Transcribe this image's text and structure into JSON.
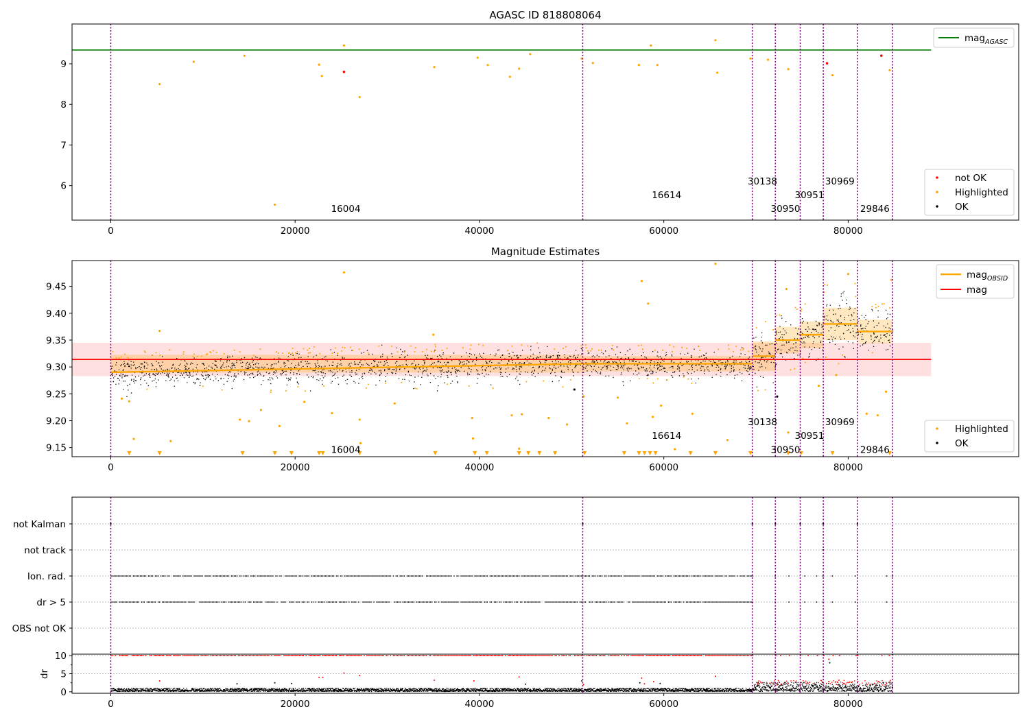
{
  "chart_data": [
    {
      "type": "scatter",
      "title": "AGASC ID 818808064",
      "xlabel": "",
      "ylabel": "",
      "xlim": [
        -4200,
        98500
      ],
      "ylim": [
        5.15,
        9.98
      ],
      "xticks": [
        0,
        20000,
        40000,
        60000,
        80000
      ],
      "xtick_labels": [
        "0",
        "20000",
        "40000",
        "60000",
        "80000"
      ],
      "yticks": [
        6,
        7,
        8,
        9
      ],
      "ytick_labels": [
        "6",
        "7",
        "8",
        "9"
      ],
      "reference_line": {
        "name": "mag_AGASC",
        "y": 9.34,
        "x_range": [
          -4200,
          89000
        ],
        "color": "#008000"
      },
      "obsid_boundaries": [
        0,
        51200,
        69600,
        72100,
        74800,
        77300,
        81000,
        84800
      ],
      "obsid_labels": [
        {
          "text": "16004",
          "x": 25500,
          "y": 5.35
        },
        {
          "text": "16614",
          "x": 60300,
          "y": 5.69
        },
        {
          "text": "30138",
          "x": 70700,
          "y": 6.03
        },
        {
          "text": "30950",
          "x": 73200,
          "y": 5.35
        },
        {
          "text": "30951",
          "x": 75800,
          "y": 5.69
        },
        {
          "text": "30969",
          "x": 79100,
          "y": 6.03
        },
        {
          "text": "29846",
          "x": 82900,
          "y": 5.35
        }
      ],
      "segments": [
        {
          "x0": 0,
          "x1": 51200,
          "y": 9.305
        },
        {
          "x0": 51200,
          "x1": 69600,
          "y": 9.315
        },
        {
          "x0": 69600,
          "x1": 72100,
          "y": 9.36
        },
        {
          "x0": 72100,
          "x1": 74800,
          "y": 9.37
        },
        {
          "x0": 74800,
          "x1": 77300,
          "y": 9.375
        },
        {
          "x0": 77300,
          "x1": 81000,
          "y": 9.41
        },
        {
          "x0": 81000,
          "x1": 84800,
          "y": 9.39
        }
      ],
      "spread": 0.035,
      "series": [
        {
          "name": "not OK",
          "color": "#ff0000",
          "points": [
            [
              25300,
              8.8
            ],
            [
              77700,
              9.01
            ],
            [
              83600,
              9.2
            ]
          ]
        },
        {
          "name": "Highlighted",
          "color": "#ffa500",
          "points": [
            [
              5300,
              8.5
            ],
            [
              17800,
              5.53
            ],
            [
              22600,
              8.98
            ],
            [
              22900,
              8.7
            ],
            [
              25300,
              9.45
            ],
            [
              27000,
              8.18
            ],
            [
              35100,
              8.92
            ],
            [
              39800,
              9.15
            ],
            [
              40900,
              8.97
            ],
            [
              43300,
              8.68
            ],
            [
              44300,
              8.88
            ],
            [
              45500,
              9.24
            ],
            [
              51100,
              9.13
            ],
            [
              52300,
              9.02
            ],
            [
              57300,
              8.97
            ],
            [
              58600,
              9.45
            ],
            [
              59300,
              8.97
            ],
            [
              65600,
              9.58
            ],
            [
              65800,
              8.78
            ],
            [
              69400,
              9.13
            ],
            [
              71300,
              9.1
            ],
            [
              73500,
              8.87
            ],
            [
              78300,
              8.72
            ],
            [
              84500,
              8.84
            ],
            [
              9000,
              9.05
            ],
            [
              14500,
              9.2
            ]
          ]
        },
        {
          "name": "OK",
          "color": "#000000",
          "points": []
        }
      ],
      "legend": {
        "position": "lower-right",
        "entries": [
          "not OK",
          "Highlighted",
          "OK"
        ]
      },
      "line_legend": {
        "position": "upper-right",
        "entries": [
          "mag_AGASC"
        ]
      }
    },
    {
      "type": "scatter",
      "title": "Magnitude Estimates",
      "xlabel": "",
      "ylabel": "",
      "xlim": [
        -4200,
        98500
      ],
      "ylim": [
        9.133,
        9.498
      ],
      "xticks": [
        0,
        20000,
        40000,
        60000,
        80000
      ],
      "xtick_labels": [
        "0",
        "20000",
        "40000",
        "60000",
        "80000"
      ],
      "yticks": [
        9.15,
        9.2,
        9.25,
        9.3,
        9.35,
        9.4,
        9.45
      ],
      "ytick_labels": [
        "9.15",
        "9.20",
        "9.25",
        "9.30",
        "9.35",
        "9.40",
        "9.45"
      ],
      "mag": {
        "name": "mag",
        "y": 9.314,
        "band": [
          9.283,
          9.345
        ],
        "x_range": [
          -4200,
          89000
        ],
        "color": "#ff0000"
      },
      "obsid_boundaries": [
        0,
        51200,
        69600,
        72100,
        74800,
        77300,
        81000,
        84800
      ],
      "obsid_labels": [
        {
          "text": "16004",
          "x": 25500,
          "y": 9.14
        },
        {
          "text": "16614",
          "x": 60300,
          "y": 9.166
        },
        {
          "text": "30138",
          "x": 70700,
          "y": 9.192
        },
        {
          "text": "30950",
          "x": 73200,
          "y": 9.14
        },
        {
          "text": "30951",
          "x": 75800,
          "y": 9.166
        },
        {
          "text": "30969",
          "x": 79100,
          "y": 9.192
        },
        {
          "text": "29846",
          "x": 82900,
          "y": 9.14
        }
      ],
      "obsid_mag": {
        "name": "mag_OBSID",
        "color": "#ffa500",
        "segments": [
          {
            "x0": 0,
            "x1": 51200,
            "y": 9.306,
            "y_start": 9.29,
            "spread": 0.03
          },
          {
            "x0": 51200,
            "x1": 69600,
            "y": 9.306,
            "y_start": 9.306,
            "spread": 0.026
          },
          {
            "x0": 69600,
            "x1": 72100,
            "y": 9.32,
            "y_start": 9.32,
            "spread": 0.05
          },
          {
            "x0": 72100,
            "x1": 74800,
            "y": 9.35,
            "y_start": 9.35,
            "spread": 0.045
          },
          {
            "x0": 74800,
            "x1": 77300,
            "y": 9.36,
            "y_start": 9.36,
            "spread": 0.045
          },
          {
            "x0": 77300,
            "x1": 81000,
            "y": 9.38,
            "y_start": 9.38,
            "spread": 0.055
          },
          {
            "x0": 81000,
            "x1": 84800,
            "y": 9.366,
            "y_start": 9.366,
            "spread": 0.04
          }
        ]
      },
      "series": [
        {
          "name": "Highlighted",
          "color": "#ffa500",
          "points": [
            [
              5300,
              9.367
            ],
            [
              2500,
              9.166
            ],
            [
              6500,
              9.162
            ],
            [
              14000,
              9.202
            ],
            [
              15000,
              9.199
            ],
            [
              16300,
              9.22
            ],
            [
              18300,
              9.19
            ],
            [
              21000,
              9.235
            ],
            [
              24000,
              9.214
            ],
            [
              25300,
              9.476
            ],
            [
              27100,
              9.158
            ],
            [
              27000,
              9.202
            ],
            [
              30800,
              9.232
            ],
            [
              35000,
              9.36
            ],
            [
              39200,
              9.205
            ],
            [
              39300,
              9.167
            ],
            [
              43500,
              9.21
            ],
            [
              44300,
              9.148
            ],
            [
              44600,
              9.212
            ],
            [
              47500,
              9.205
            ],
            [
              49500,
              9.193
            ],
            [
              51300,
              9.245
            ],
            [
              55000,
              9.243
            ],
            [
              56000,
              9.195
            ],
            [
              57600,
              9.46
            ],
            [
              58300,
              9.418
            ],
            [
              58800,
              9.207
            ],
            [
              59700,
              9.228
            ],
            [
              61200,
              9.147
            ],
            [
              63100,
              9.213
            ],
            [
              65600,
              9.492
            ],
            [
              66900,
              9.164
            ],
            [
              73500,
              9.178
            ],
            [
              73300,
              9.445
            ],
            [
              76800,
              9.265
            ],
            [
              80000,
              9.473
            ],
            [
              82000,
              9.213
            ],
            [
              83200,
              9.21
            ],
            [
              84100,
              9.254
            ],
            [
              84700,
              9.462
            ],
            [
              78700,
              9.285
            ],
            [
              1200,
              9.241
            ],
            [
              2000,
              9.236
            ]
          ]
        },
        {
          "name": "OK",
          "color": "#000000",
          "points": [
            [
              50300,
              9.258
            ],
            [
              72300,
              9.245
            ]
          ]
        }
      ],
      "off_scale_markers": [
        2000,
        5300,
        14300,
        17800,
        19600,
        22600,
        23000,
        27000,
        35200,
        39500,
        40800,
        44300,
        45300,
        46500,
        48200,
        51400,
        55700,
        57300,
        57900,
        58500,
        59100,
        62900,
        65600,
        69400,
        73500,
        74900,
        78300,
        84500
      ],
      "legend": {
        "position": "lower-right",
        "entries": [
          "Highlighted",
          "OK"
        ]
      },
      "line_legend": {
        "position": "upper-right",
        "entries": [
          "mag_OBSID",
          "mag"
        ]
      }
    },
    {
      "type": "scatter",
      "title": "",
      "xlabel": "",
      "ylabel": "",
      "xlim": [
        -4200,
        98500
      ],
      "flags": [
        "not Kalman",
        "not track",
        "Ion. rad.",
        "dr > 5",
        "OBS not OK"
      ],
      "flag_points": {
        "not Kalman": [
          0,
          51200,
          69600,
          72100,
          74800,
          77300,
          81000
        ],
        "not track": [
          77300
        ],
        "Ion. rad.": {
          "dense_range": [
            0,
            69600
          ],
          "sparse": [
            72100,
            73600,
            75300,
            76600,
            77300,
            78300,
            80800,
            84200,
            84800
          ]
        },
        "dr > 5": {
          "dense_range": [
            0,
            69600
          ],
          "sparse": [
            72100,
            73600,
            75300,
            76600,
            77300,
            78300,
            80800,
            84200,
            84800
          ]
        },
        "OBS not OK": []
      },
      "obsid_boundaries": [
        0,
        51200,
        69600,
        72100,
        74800,
        77300,
        81000,
        84800
      ]
    },
    {
      "type": "scatter",
      "title": "",
      "xlabel": "",
      "ylabel": "dr",
      "xlim": [
        -4200,
        98500
      ],
      "ylim": [
        -0.4,
        10.4
      ],
      "xticks": [
        0,
        20000,
        40000,
        60000,
        80000
      ],
      "xtick_labels": [
        "0",
        "20000",
        "40000",
        "60000",
        "80000"
      ],
      "yticks": [
        0,
        5,
        10
      ],
      "ytick_labels": [
        "0",
        "5",
        "10"
      ],
      "red_at_10": {
        "dense_range": [
          0,
          69600
        ],
        "sparse": [
          72100,
          72600,
          73600,
          74800,
          75600,
          76600,
          77300,
          78300,
          79000,
          80800,
          81000,
          83600,
          84400
        ]
      },
      "red_points": [
        [
          5300,
          3.0
        ],
        [
          22600,
          4.0
        ],
        [
          23000,
          4.0
        ],
        [
          25300,
          5.2
        ],
        [
          27000,
          4.5
        ],
        [
          35100,
          3.2
        ],
        [
          39400,
          3.0
        ],
        [
          44300,
          4.1
        ],
        [
          65600,
          4.3
        ],
        [
          57600,
          3.8
        ],
        [
          57900,
          2.2
        ],
        [
          58900,
          2.8
        ],
        [
          51300,
          2.0
        ],
        [
          77900,
          9.0
        ],
        [
          79000,
          3.2
        ]
      ],
      "black_points": [
        [
          13700,
          2.2
        ],
        [
          17800,
          2.5
        ],
        [
          19600,
          2.3
        ],
        [
          45000,
          2.1
        ],
        [
          51100,
          3.0
        ],
        [
          57400,
          2.5
        ],
        [
          59600,
          2.3
        ],
        [
          78000,
          8.0
        ]
      ],
      "obsid_boundaries": [
        0,
        51200,
        69600,
        72100,
        74800,
        77300,
        81000,
        84800
      ]
    }
  ]
}
